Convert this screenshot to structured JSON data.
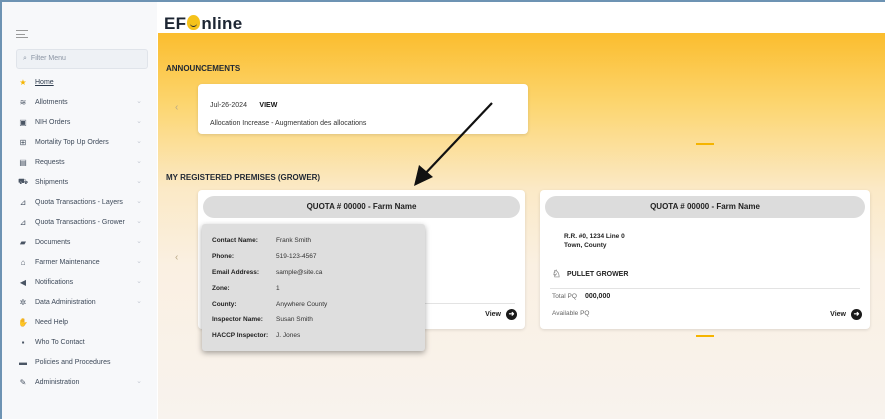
{
  "app": {
    "logo_left": "EF",
    "logo_right": "nline"
  },
  "sidebar": {
    "filter_placeholder": "Filter Menu",
    "items": [
      {
        "label": "Home",
        "icon": "home-icon",
        "glyph": "★",
        "active": true,
        "chevron": false
      },
      {
        "label": "Allotments",
        "icon": "layers-icon",
        "glyph": "≋",
        "chevron": true
      },
      {
        "label": "NIH Orders",
        "icon": "cart-icon",
        "glyph": "▣",
        "chevron": true
      },
      {
        "label": "Mortality Top Up Orders",
        "icon": "plus-square-icon",
        "glyph": "⊞",
        "chevron": true
      },
      {
        "label": "Requests",
        "icon": "clipboard-icon",
        "glyph": "▤",
        "chevron": true
      },
      {
        "label": "Shipments",
        "icon": "truck-icon",
        "glyph": "⛟",
        "chevron": true
      },
      {
        "label": "Quota Transactions - Layers",
        "icon": "chart-icon",
        "glyph": "⊿",
        "chevron": true
      },
      {
        "label": "Quota Transactions - Grower",
        "icon": "chart-icon",
        "glyph": "⊿",
        "chevron": true
      },
      {
        "label": "Documents",
        "icon": "folder-icon",
        "glyph": "▰",
        "chevron": true
      },
      {
        "label": "Farmer Maintenance",
        "icon": "barn-icon",
        "glyph": "⌂",
        "chevron": true
      },
      {
        "label": "Notifications",
        "icon": "megaphone-icon",
        "glyph": "◀",
        "chevron": true
      },
      {
        "label": "Data Administration",
        "icon": "gear-icon",
        "glyph": "✲",
        "chevron": true
      },
      {
        "label": "Need Help",
        "icon": "handshake-icon",
        "glyph": "✋",
        "chevron": false
      },
      {
        "label": "Who To Contact",
        "icon": "contact-icon",
        "glyph": "▪",
        "chevron": false
      },
      {
        "label": "Policies and Procedures",
        "icon": "book-icon",
        "glyph": "▬",
        "chevron": false
      },
      {
        "label": "Administration",
        "icon": "wrench-icon",
        "glyph": "✎",
        "chevron": true
      }
    ]
  },
  "announcements": {
    "title": "ANNOUNCEMENTS",
    "date": "Jul-26-2024",
    "view_label": "VIEW",
    "text": "Allocation Increase - Augmentation des allocations"
  },
  "premises": {
    "title": "MY REGISTERED PREMISES (GROWER)",
    "card1": {
      "quota": "QUOTA #   00000 - Farm Name",
      "view_label": "View"
    },
    "card2": {
      "quota": "QUOTA # 00000 - Farm Name",
      "address1": "R.R. #0, 1234 Line 0",
      "address2": "Town, County",
      "grower_type": "PULLET GROWER",
      "total_pq_label": "Total PQ",
      "total_pq_value": "000,000",
      "available_pq_label": "Available PQ",
      "view_label": "View"
    }
  },
  "contact_popup": {
    "rows": [
      {
        "key": "Contact Name:",
        "value": "Frank Smith"
      },
      {
        "key": "Phone:",
        "value": "519-123-4567"
      },
      {
        "key": "Email Address:",
        "value": "sample@site.ca"
      },
      {
        "key": "Zone:",
        "value": "1"
      },
      {
        "key": "County:",
        "value": "Anywhere County"
      },
      {
        "key": "Inspector Name:",
        "value": "Susan Smith"
      },
      {
        "key": "HACCP Inspector:",
        "value": "J. Jones"
      }
    ]
  },
  "colors": {
    "accent": "#f5b400",
    "frame": "#3d6f97"
  }
}
